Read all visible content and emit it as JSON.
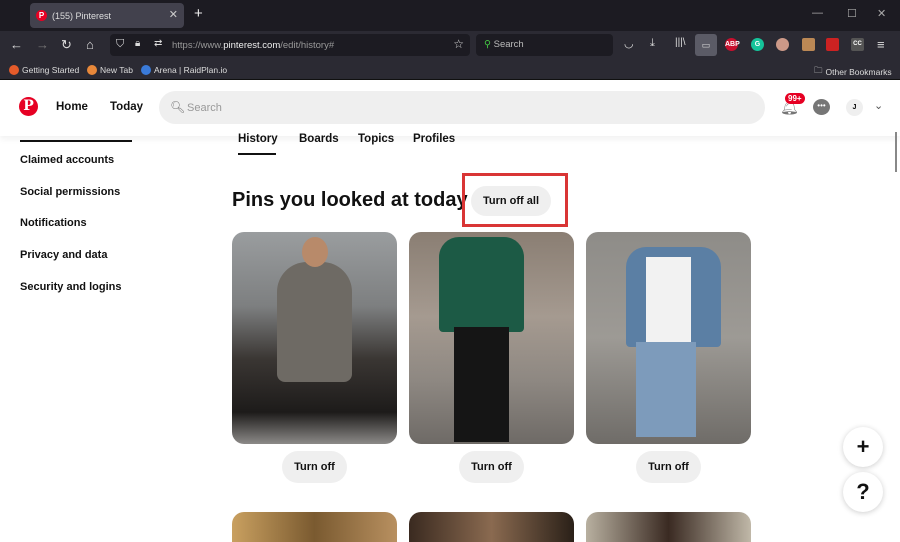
{
  "browser": {
    "tab_title": "(155) Pinterest",
    "url_prefix": "https://www.",
    "url_domain": "pinterest.com",
    "url_path": "/edit/history#",
    "search_placeholder": "Search",
    "bookmarks": [
      "Getting Started",
      "New Tab",
      "Arena | RaidPlan.io"
    ],
    "other_bookmarks": "Other Bookmarks",
    "toolbar_icons": [
      "pocket-icon",
      "download-icon",
      "library-icon",
      "reader-view-icon",
      "adblock-plus-icon",
      "grammarly-icon",
      "extension-icon",
      "extension-icon",
      "extension-icon",
      "cc-icon",
      "menu-icon"
    ],
    "abp_label": "ABP",
    "grammarly_label": "G"
  },
  "header": {
    "logo": "P",
    "home": "Home",
    "today": "Today",
    "search_placeholder": "Search",
    "notification_count": "99+",
    "avatar_initial": "J"
  },
  "sidebar": {
    "items": [
      "Claimed accounts",
      "Social permissions",
      "Notifications",
      "Privacy and data",
      "Security and logins"
    ]
  },
  "tabs": [
    "History",
    "Boards",
    "Topics",
    "Profiles"
  ],
  "main": {
    "heading": "Pins you looked at today",
    "turn_off_all": "Turn off all",
    "turn_off": "Turn off"
  },
  "fab": {
    "add": "+",
    "help": "?"
  },
  "colors": {
    "brand": "#e60023",
    "highlight": "#d93535"
  }
}
